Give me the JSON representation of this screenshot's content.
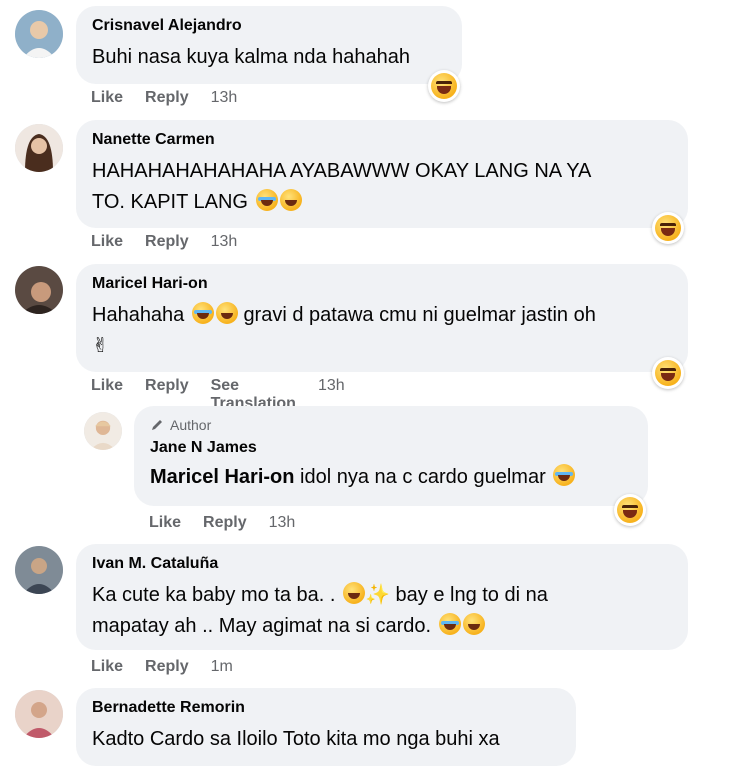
{
  "comments": [
    {
      "name": "Crisnavel Alejandro",
      "text": "Buhi nasa kuya kalma nda hahahah",
      "like": "Like",
      "reply": "Reply",
      "time": "13h"
    },
    {
      "name": "Nanette Carmen",
      "text_line1": "HAHAHAHAHAHAHA AYABAWWW OKAY LANG NA YA",
      "text_line2": "TO. KAPIT LANG",
      "like": "Like",
      "reply": "Reply",
      "time": "13h"
    },
    {
      "name": "Maricel Hari-on",
      "text_part1": "Hahahaha",
      "text_part2": "gravi d patawa cmu ni guelmar jastin oh",
      "peace": "✌",
      "like": "Like",
      "reply": "Reply",
      "translate": "See Translation",
      "time": "13h"
    },
    {
      "author_label": "Author",
      "name": "Jane N James",
      "mention": "Maricel Hari-on",
      "text": " idol nya na c cardo guelmar",
      "like": "Like",
      "reply": "Reply",
      "time": "13h"
    },
    {
      "name": "Ivan M. Cataluña",
      "text_line1": "Ka cute ka baby mo ta ba. .",
      "text_line1b": "bay e lng to di na",
      "text_line2": "mapatay ah .. May agimat na si cardo.",
      "like": "Like",
      "reply": "Reply",
      "time": "1m"
    },
    {
      "name": "Bernadette Remorin",
      "text": "Kadto Cardo sa Iloilo Toto kita mo nga buhi xa"
    }
  ],
  "colors": {
    "bubble": "#f0f2f5",
    "meta": "#65676b",
    "text": "#050505"
  }
}
